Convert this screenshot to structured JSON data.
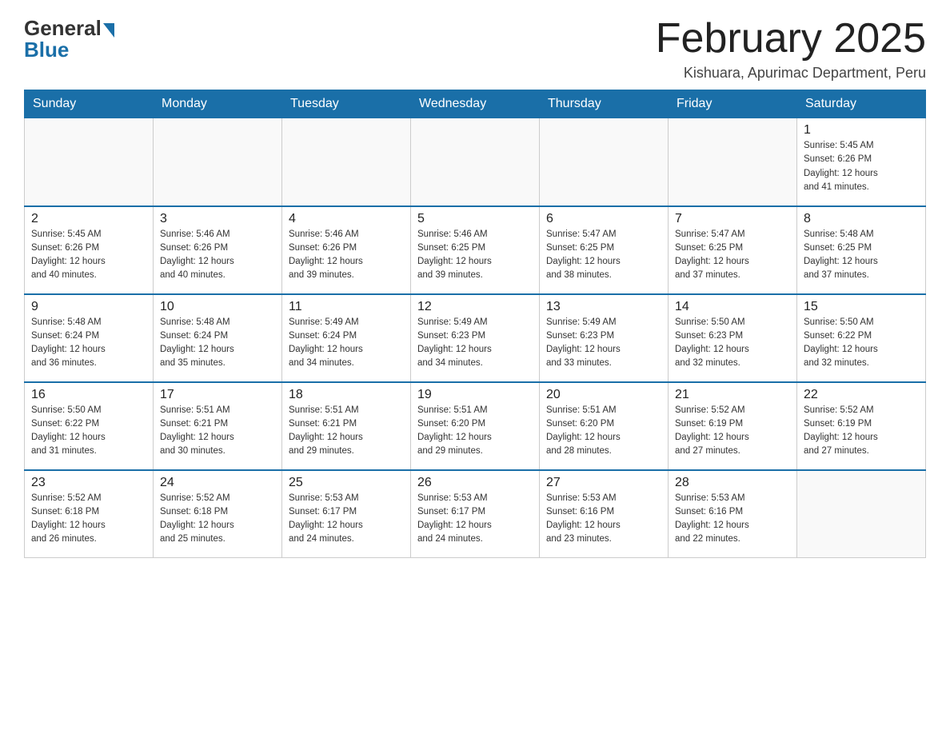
{
  "logo": {
    "general": "General",
    "blue": "Blue"
  },
  "title": "February 2025",
  "location": "Kishuara, Apurimac Department, Peru",
  "weekdays": [
    "Sunday",
    "Monday",
    "Tuesday",
    "Wednesday",
    "Thursday",
    "Friday",
    "Saturday"
  ],
  "weeks": [
    [
      {
        "day": "",
        "info": ""
      },
      {
        "day": "",
        "info": ""
      },
      {
        "day": "",
        "info": ""
      },
      {
        "day": "",
        "info": ""
      },
      {
        "day": "",
        "info": ""
      },
      {
        "day": "",
        "info": ""
      },
      {
        "day": "1",
        "info": "Sunrise: 5:45 AM\nSunset: 6:26 PM\nDaylight: 12 hours\nand 41 minutes."
      }
    ],
    [
      {
        "day": "2",
        "info": "Sunrise: 5:45 AM\nSunset: 6:26 PM\nDaylight: 12 hours\nand 40 minutes."
      },
      {
        "day": "3",
        "info": "Sunrise: 5:46 AM\nSunset: 6:26 PM\nDaylight: 12 hours\nand 40 minutes."
      },
      {
        "day": "4",
        "info": "Sunrise: 5:46 AM\nSunset: 6:26 PM\nDaylight: 12 hours\nand 39 minutes."
      },
      {
        "day": "5",
        "info": "Sunrise: 5:46 AM\nSunset: 6:25 PM\nDaylight: 12 hours\nand 39 minutes."
      },
      {
        "day": "6",
        "info": "Sunrise: 5:47 AM\nSunset: 6:25 PM\nDaylight: 12 hours\nand 38 minutes."
      },
      {
        "day": "7",
        "info": "Sunrise: 5:47 AM\nSunset: 6:25 PM\nDaylight: 12 hours\nand 37 minutes."
      },
      {
        "day": "8",
        "info": "Sunrise: 5:48 AM\nSunset: 6:25 PM\nDaylight: 12 hours\nand 37 minutes."
      }
    ],
    [
      {
        "day": "9",
        "info": "Sunrise: 5:48 AM\nSunset: 6:24 PM\nDaylight: 12 hours\nand 36 minutes."
      },
      {
        "day": "10",
        "info": "Sunrise: 5:48 AM\nSunset: 6:24 PM\nDaylight: 12 hours\nand 35 minutes."
      },
      {
        "day": "11",
        "info": "Sunrise: 5:49 AM\nSunset: 6:24 PM\nDaylight: 12 hours\nand 34 minutes."
      },
      {
        "day": "12",
        "info": "Sunrise: 5:49 AM\nSunset: 6:23 PM\nDaylight: 12 hours\nand 34 minutes."
      },
      {
        "day": "13",
        "info": "Sunrise: 5:49 AM\nSunset: 6:23 PM\nDaylight: 12 hours\nand 33 minutes."
      },
      {
        "day": "14",
        "info": "Sunrise: 5:50 AM\nSunset: 6:23 PM\nDaylight: 12 hours\nand 32 minutes."
      },
      {
        "day": "15",
        "info": "Sunrise: 5:50 AM\nSunset: 6:22 PM\nDaylight: 12 hours\nand 32 minutes."
      }
    ],
    [
      {
        "day": "16",
        "info": "Sunrise: 5:50 AM\nSunset: 6:22 PM\nDaylight: 12 hours\nand 31 minutes."
      },
      {
        "day": "17",
        "info": "Sunrise: 5:51 AM\nSunset: 6:21 PM\nDaylight: 12 hours\nand 30 minutes."
      },
      {
        "day": "18",
        "info": "Sunrise: 5:51 AM\nSunset: 6:21 PM\nDaylight: 12 hours\nand 29 minutes."
      },
      {
        "day": "19",
        "info": "Sunrise: 5:51 AM\nSunset: 6:20 PM\nDaylight: 12 hours\nand 29 minutes."
      },
      {
        "day": "20",
        "info": "Sunrise: 5:51 AM\nSunset: 6:20 PM\nDaylight: 12 hours\nand 28 minutes."
      },
      {
        "day": "21",
        "info": "Sunrise: 5:52 AM\nSunset: 6:19 PM\nDaylight: 12 hours\nand 27 minutes."
      },
      {
        "day": "22",
        "info": "Sunrise: 5:52 AM\nSunset: 6:19 PM\nDaylight: 12 hours\nand 27 minutes."
      }
    ],
    [
      {
        "day": "23",
        "info": "Sunrise: 5:52 AM\nSunset: 6:18 PM\nDaylight: 12 hours\nand 26 minutes."
      },
      {
        "day": "24",
        "info": "Sunrise: 5:52 AM\nSunset: 6:18 PM\nDaylight: 12 hours\nand 25 minutes."
      },
      {
        "day": "25",
        "info": "Sunrise: 5:53 AM\nSunset: 6:17 PM\nDaylight: 12 hours\nand 24 minutes."
      },
      {
        "day": "26",
        "info": "Sunrise: 5:53 AM\nSunset: 6:17 PM\nDaylight: 12 hours\nand 24 minutes."
      },
      {
        "day": "27",
        "info": "Sunrise: 5:53 AM\nSunset: 6:16 PM\nDaylight: 12 hours\nand 23 minutes."
      },
      {
        "day": "28",
        "info": "Sunrise: 5:53 AM\nSunset: 6:16 PM\nDaylight: 12 hours\nand 22 minutes."
      },
      {
        "day": "",
        "info": ""
      }
    ]
  ]
}
